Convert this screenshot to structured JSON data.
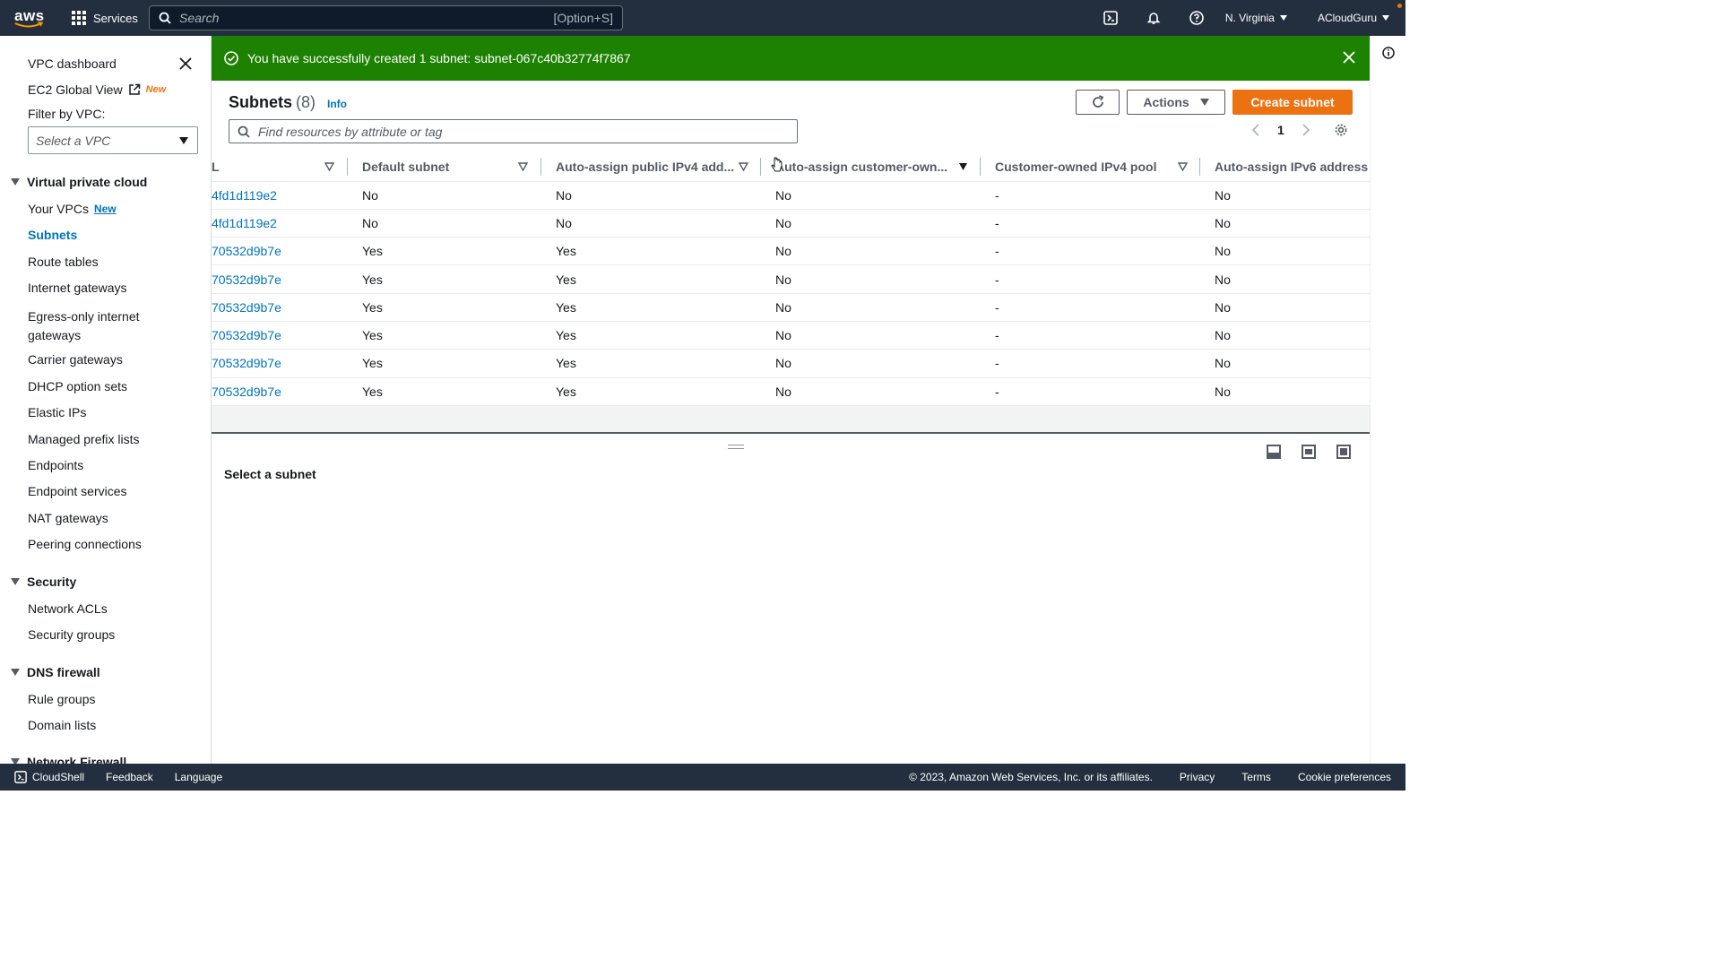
{
  "topnav": {
    "logo_text": "aws",
    "services_label": "Services",
    "search_placeholder": "Search",
    "search_shortcut": "[Option+S]",
    "region": "N. Virginia",
    "account": "ACloudGuru"
  },
  "flash": {
    "message": "You have successfully created 1 subnet: subnet-067c40b32774f7867"
  },
  "sidebar": {
    "vpc_dashboard": "VPC dashboard",
    "ec2_global_view": "EC2 Global View",
    "ec2_new_badge": "New",
    "filter_label": "Filter by VPC:",
    "vpc_select_placeholder": "Select a VPC",
    "sections": {
      "vpc": "Virtual private cloud",
      "security": "Security",
      "dns": "DNS firewall",
      "network_firewall": "Network Firewall"
    },
    "vpc_items": [
      "Your VPCs",
      "Subnets",
      "Route tables",
      "Internet gateways",
      "Egress-only internet gateways",
      "Carrier gateways",
      "DHCP option sets",
      "Elastic IPs",
      "Managed prefix lists",
      "Endpoints",
      "Endpoint services",
      "NAT gateways",
      "Peering connections"
    ],
    "your_vpcs_new_badge": "New",
    "security_items": [
      "Network ACLs",
      "Security groups"
    ],
    "dns_items": [
      "Rule groups",
      "Domain lists"
    ]
  },
  "main": {
    "title": "Subnets",
    "count": "(8)",
    "info_link": "Info",
    "actions_label": "Actions",
    "create_label": "Create subnet",
    "filter_placeholder": "Find resources by attribute or tag",
    "page_number": "1"
  },
  "table": {
    "columns": [
      "L",
      "Default subnet",
      "Auto-assign public IPv4 add...",
      "Auto-assign customer-own...",
      "Customer-owned IPv4 pool",
      "Auto-assign IPv6 address"
    ],
    "rows": [
      [
        "4fd1d119e2",
        "No",
        "No",
        "No",
        "-",
        "No"
      ],
      [
        "4fd1d119e2",
        "No",
        "No",
        "No",
        "-",
        "No"
      ],
      [
        "70532d9b7e",
        "Yes",
        "Yes",
        "No",
        "-",
        "No"
      ],
      [
        "70532d9b7e",
        "Yes",
        "Yes",
        "No",
        "-",
        "No"
      ],
      [
        "70532d9b7e",
        "Yes",
        "Yes",
        "No",
        "-",
        "No"
      ],
      [
        "70532d9b7e",
        "Yes",
        "Yes",
        "No",
        "-",
        "No"
      ],
      [
        "70532d9b7e",
        "Yes",
        "Yes",
        "No",
        "-",
        "No"
      ],
      [
        "70532d9b7e",
        "Yes",
        "Yes",
        "No",
        "-",
        "No"
      ]
    ]
  },
  "split_panel": {
    "title": "Select a subnet"
  },
  "footer": {
    "cloudshell": "CloudShell",
    "feedback": "Feedback",
    "language": "Language",
    "copyright": "© 2023, Amazon Web Services, Inc. or its affiliates.",
    "privacy": "Privacy",
    "terms": "Terms",
    "cookies": "Cookie preferences"
  },
  "colors": {
    "nav_bg": "#232f3e",
    "success_green": "#1d8102",
    "primary_orange": "#ec7211",
    "link_blue": "#0073bb"
  }
}
